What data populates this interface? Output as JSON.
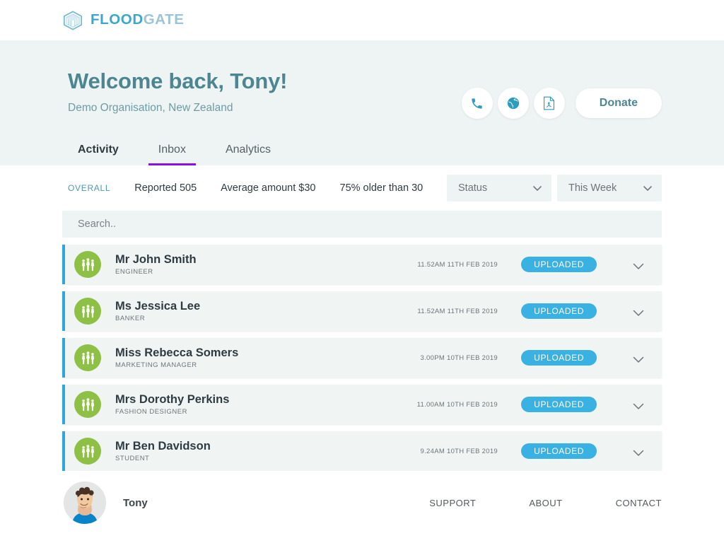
{
  "brand": {
    "name_part1": "FLOOD",
    "name_part2": "GATE",
    "logo_icon": "hexagon-logo-icon",
    "color_primary": "#3ba7cb",
    "color_secondary": "#9dc3d4"
  },
  "hero": {
    "title": "Welcome back, Tony!",
    "subtitle": "Demo Organisation, New Zealand",
    "actions": {
      "phone_icon": "phone-icon",
      "globe_icon": "globe-icon",
      "pdf_icon": "pdf-file-icon",
      "donate_label": "Donate"
    },
    "accent_color": "#4d8691",
    "background": "#eef4f3"
  },
  "tabs": [
    {
      "label": "Activity",
      "active": false,
      "bold": true
    },
    {
      "label": "Inbox",
      "active": true,
      "bold": false
    },
    {
      "label": "Analytics",
      "active": false,
      "bold": false
    }
  ],
  "tab_indicator_color": "#8412e8",
  "stats": {
    "overall_label": "OVERALL",
    "items": [
      "Reported 505",
      "Average amount $30",
      "75% older than 30"
    ]
  },
  "filters": [
    {
      "name": "status",
      "value": "Status",
      "icon": "chevron-down-icon"
    },
    {
      "name": "date-range",
      "value": "This Week",
      "icon": "chevron-down-icon"
    }
  ],
  "search": {
    "placeholder": "Search..",
    "value": ""
  },
  "list": {
    "rows": [
      {
        "name": "Mr John Smith",
        "role": "ENGINEER",
        "time": "11.52AM 11TH FEB 2019",
        "status": "UPLOADED",
        "avatar_icon": "people-group-icon"
      },
      {
        "name": "Ms Jessica Lee",
        "role": "BANKER",
        "time": "11.52AM 11TH FEB 2019",
        "status": "UPLOADED",
        "avatar_icon": "people-group-icon"
      },
      {
        "name": "Miss Rebecca Somers",
        "role": "MARKETING MANAGER",
        "time": "3.00PM 10TH FEB 2019",
        "status": "UPLOADED",
        "avatar_icon": "people-group-icon"
      },
      {
        "name": "Mrs Dorothy Perkins",
        "role": "FASHION DESIGNER",
        "time": "11.00AM 10TH FEB 2019",
        "status": "UPLOADED",
        "avatar_icon": "people-group-icon"
      },
      {
        "name": "Mr Ben Davidson",
        "role": "STUDENT",
        "time": "9.24AM 10TH FEB 2019",
        "status": "UPLOADED",
        "avatar_icon": "people-group-icon"
      }
    ],
    "status_color": "#39b1e3",
    "accent_bar_color": "#2ea6dd",
    "avatar_color": "#8dc044",
    "row_background": "#f0f5f4",
    "expand_icon": "chevron-down-icon"
  },
  "footer": {
    "user_name": "Tony",
    "user_avatar": "user-photo-avatar",
    "links": [
      "SUPPORT",
      "ABOUT",
      "CONTACT"
    ]
  }
}
